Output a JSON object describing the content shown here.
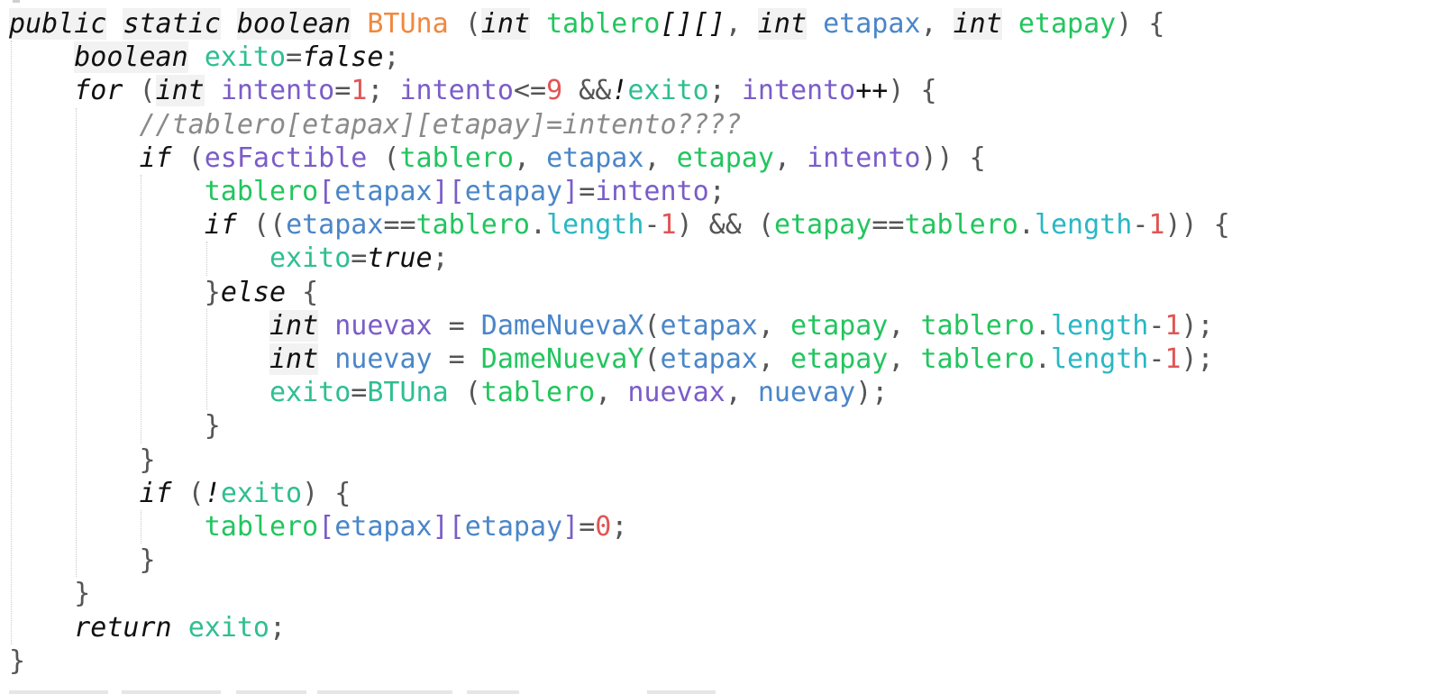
{
  "code": {
    "lines": [
      {
        "tokens": [
          {
            "t": "public",
            "c": "kwbg"
          },
          {
            "t": " ",
            "c": "pu"
          },
          {
            "t": "static",
            "c": "kwbg"
          },
          {
            "t": " ",
            "c": "pu"
          },
          {
            "t": "boolean",
            "c": "kwbg"
          },
          {
            "t": " ",
            "c": "pu"
          },
          {
            "t": "BTUna",
            "c": "orange"
          },
          {
            "t": " (",
            "c": "pu"
          },
          {
            "t": "int",
            "c": "kwbg"
          },
          {
            "t": " ",
            "c": "pu"
          },
          {
            "t": "tablero",
            "c": "green"
          },
          {
            "t": "[][]",
            "c": "kw"
          },
          {
            "t": ", ",
            "c": "pu"
          },
          {
            "t": "int",
            "c": "kwbg"
          },
          {
            "t": " ",
            "c": "pu"
          },
          {
            "t": "etapax",
            "c": "blue"
          },
          {
            "t": ", ",
            "c": "pu"
          },
          {
            "t": "int",
            "c": "kwbg"
          },
          {
            "t": " ",
            "c": "pu"
          },
          {
            "t": "etapay",
            "c": "green"
          },
          {
            "t": ") {",
            "c": "pu"
          }
        ]
      },
      {
        "tokens": [
          {
            "t": "    ",
            "c": "pu"
          },
          {
            "t": "boolean",
            "c": "kwbg"
          },
          {
            "t": " ",
            "c": "pu"
          },
          {
            "t": "exito",
            "c": "teal"
          },
          {
            "t": "=",
            "c": "pu"
          },
          {
            "t": "false",
            "c": "kw"
          },
          {
            "t": ";",
            "c": "pu"
          }
        ]
      },
      {
        "tokens": [
          {
            "t": "    ",
            "c": "pu"
          },
          {
            "t": "for",
            "c": "kw"
          },
          {
            "t": " (",
            "c": "pu"
          },
          {
            "t": "int",
            "c": "kwbg"
          },
          {
            "t": " ",
            "c": "pu"
          },
          {
            "t": "intento",
            "c": "purple"
          },
          {
            "t": "=",
            "c": "pu"
          },
          {
            "t": "1",
            "c": "red"
          },
          {
            "t": "; ",
            "c": "pu"
          },
          {
            "t": "intento",
            "c": "purple"
          },
          {
            "t": "<=",
            "c": "pu"
          },
          {
            "t": "9",
            "c": "red"
          },
          {
            "t": " &&",
            "c": "pu"
          },
          {
            "t": "!",
            "c": "kw"
          },
          {
            "t": "exito",
            "c": "teal"
          },
          {
            "t": "; ",
            "c": "pu"
          },
          {
            "t": "intento",
            "c": "purple"
          },
          {
            "t": "++",
            "c": "kw"
          },
          {
            "t": ") {",
            "c": "pu"
          }
        ]
      },
      {
        "tokens": [
          {
            "t": "        ",
            "c": "pu"
          },
          {
            "t": "//tablero[etapax][etapay]=intento????",
            "c": "comment"
          }
        ]
      },
      {
        "tokens": [
          {
            "t": "        ",
            "c": "pu"
          },
          {
            "t": "if",
            "c": "kw"
          },
          {
            "t": " (",
            "c": "pu"
          },
          {
            "t": "esFactible",
            "c": "purple"
          },
          {
            "t": " (",
            "c": "pu"
          },
          {
            "t": "tablero",
            "c": "green"
          },
          {
            "t": ", ",
            "c": "pu"
          },
          {
            "t": "etapax",
            "c": "blue"
          },
          {
            "t": ", ",
            "c": "pu"
          },
          {
            "t": "etapay",
            "c": "green"
          },
          {
            "t": ", ",
            "c": "pu"
          },
          {
            "t": "intento",
            "c": "purple"
          },
          {
            "t": ")) {",
            "c": "pu"
          }
        ]
      },
      {
        "tokens": [
          {
            "t": "            ",
            "c": "pu"
          },
          {
            "t": "tablero",
            "c": "green"
          },
          {
            "t": "[",
            "c": "purple"
          },
          {
            "t": "etapax",
            "c": "blue"
          },
          {
            "t": "]",
            "c": "purple"
          },
          {
            "t": "[",
            "c": "purple"
          },
          {
            "t": "etapay",
            "c": "blue"
          },
          {
            "t": "]",
            "c": "purple"
          },
          {
            "t": "=",
            "c": "pu"
          },
          {
            "t": "intento",
            "c": "purple"
          },
          {
            "t": ";",
            "c": "pu"
          }
        ]
      },
      {
        "tokens": [
          {
            "t": "            ",
            "c": "pu"
          },
          {
            "t": "if",
            "c": "kw"
          },
          {
            "t": " ((",
            "c": "pu"
          },
          {
            "t": "etapax",
            "c": "blue"
          },
          {
            "t": "==",
            "c": "pu"
          },
          {
            "t": "tablero",
            "c": "green"
          },
          {
            "t": ".",
            "c": "pu"
          },
          {
            "t": "length",
            "c": "cyan"
          },
          {
            "t": "-",
            "c": "pu"
          },
          {
            "t": "1",
            "c": "red"
          },
          {
            "t": ") && (",
            "c": "pu"
          },
          {
            "t": "etapay",
            "c": "green"
          },
          {
            "t": "==",
            "c": "pu"
          },
          {
            "t": "tablero",
            "c": "green"
          },
          {
            "t": ".",
            "c": "pu"
          },
          {
            "t": "length",
            "c": "cyan"
          },
          {
            "t": "-",
            "c": "pu"
          },
          {
            "t": "1",
            "c": "red"
          },
          {
            "t": ")) {",
            "c": "pu"
          }
        ]
      },
      {
        "tokens": [
          {
            "t": "                ",
            "c": "pu"
          },
          {
            "t": "exito",
            "c": "teal"
          },
          {
            "t": "=",
            "c": "pu"
          },
          {
            "t": "true",
            "c": "kw"
          },
          {
            "t": ";",
            "c": "pu"
          }
        ]
      },
      {
        "tokens": [
          {
            "t": "            ",
            "c": "pu"
          },
          {
            "t": "}",
            "c": "pu"
          },
          {
            "t": "else",
            "c": "kw"
          },
          {
            "t": " {",
            "c": "pu"
          }
        ]
      },
      {
        "tokens": [
          {
            "t": "                ",
            "c": "pu"
          },
          {
            "t": "int",
            "c": "kwbg"
          },
          {
            "t": " ",
            "c": "pu"
          },
          {
            "t": "nuevax",
            "c": "purple"
          },
          {
            "t": " = ",
            "c": "pu"
          },
          {
            "t": "DameNuevaX",
            "c": "blue"
          },
          {
            "t": "(",
            "c": "pu"
          },
          {
            "t": "etapax",
            "c": "blue"
          },
          {
            "t": ", ",
            "c": "pu"
          },
          {
            "t": "etapay",
            "c": "green"
          },
          {
            "t": ", ",
            "c": "pu"
          },
          {
            "t": "tablero",
            "c": "green"
          },
          {
            "t": ".",
            "c": "pu"
          },
          {
            "t": "length",
            "c": "cyan"
          },
          {
            "t": "-",
            "c": "pu"
          },
          {
            "t": "1",
            "c": "red"
          },
          {
            "t": ");",
            "c": "pu"
          }
        ]
      },
      {
        "tokens": [
          {
            "t": "                ",
            "c": "pu"
          },
          {
            "t": "int",
            "c": "kwbg"
          },
          {
            "t": " ",
            "c": "pu"
          },
          {
            "t": "nuevay",
            "c": "blue"
          },
          {
            "t": " = ",
            "c": "pu"
          },
          {
            "t": "DameNuevaY",
            "c": "green"
          },
          {
            "t": "(",
            "c": "pu"
          },
          {
            "t": "etapax",
            "c": "blue"
          },
          {
            "t": ", ",
            "c": "pu"
          },
          {
            "t": "etapay",
            "c": "green"
          },
          {
            "t": ", ",
            "c": "pu"
          },
          {
            "t": "tablero",
            "c": "green"
          },
          {
            "t": ".",
            "c": "pu"
          },
          {
            "t": "length",
            "c": "cyan"
          },
          {
            "t": "-",
            "c": "pu"
          },
          {
            "t": "1",
            "c": "red"
          },
          {
            "t": ");",
            "c": "pu"
          }
        ]
      },
      {
        "tokens": [
          {
            "t": "                ",
            "c": "pu"
          },
          {
            "t": "exito",
            "c": "teal"
          },
          {
            "t": "=",
            "c": "pu"
          },
          {
            "t": "BTUna",
            "c": "teal"
          },
          {
            "t": " (",
            "c": "pu"
          },
          {
            "t": "tablero",
            "c": "green"
          },
          {
            "t": ", ",
            "c": "pu"
          },
          {
            "t": "nuevax",
            "c": "purple"
          },
          {
            "t": ", ",
            "c": "pu"
          },
          {
            "t": "nuevay",
            "c": "blue"
          },
          {
            "t": ");",
            "c": "pu"
          }
        ]
      },
      {
        "tokens": [
          {
            "t": "            ",
            "c": "pu"
          },
          {
            "t": "}",
            "c": "pu"
          }
        ]
      },
      {
        "tokens": [
          {
            "t": "        ",
            "c": "pu"
          },
          {
            "t": "}",
            "c": "pu"
          }
        ]
      },
      {
        "tokens": [
          {
            "t": "        ",
            "c": "pu"
          },
          {
            "t": "if",
            "c": "kw"
          },
          {
            "t": " (",
            "c": "pu"
          },
          {
            "t": "!",
            "c": "kw"
          },
          {
            "t": "exito",
            "c": "teal"
          },
          {
            "t": ") {",
            "c": "pu"
          }
        ]
      },
      {
        "tokens": [
          {
            "t": "            ",
            "c": "pu"
          },
          {
            "t": "tablero",
            "c": "green"
          },
          {
            "t": "[",
            "c": "purple"
          },
          {
            "t": "etapax",
            "c": "blue"
          },
          {
            "t": "]",
            "c": "purple"
          },
          {
            "t": "[",
            "c": "purple"
          },
          {
            "t": "etapay",
            "c": "blue"
          },
          {
            "t": "]",
            "c": "purple"
          },
          {
            "t": "=",
            "c": "pu"
          },
          {
            "t": "0",
            "c": "red"
          },
          {
            "t": ";",
            "c": "pu"
          }
        ]
      },
      {
        "tokens": [
          {
            "t": "        ",
            "c": "pu"
          },
          {
            "t": "}",
            "c": "pu"
          }
        ]
      },
      {
        "tokens": [
          {
            "t": "    ",
            "c": "pu"
          },
          {
            "t": "}",
            "c": "pu"
          }
        ]
      },
      {
        "tokens": [
          {
            "t": "    ",
            "c": "pu"
          },
          {
            "t": "return",
            "c": "kw"
          },
          {
            "t": " ",
            "c": "pu"
          },
          {
            "t": "exito",
            "c": "teal"
          },
          {
            "t": ";",
            "c": "pu"
          }
        ]
      },
      {
        "tokens": [
          {
            "t": "}",
            "c": "pu"
          }
        ]
      }
    ]
  },
  "colors": {
    "background": "#ffffff",
    "keyword": "#111111",
    "keyword_highlight": "#f2f2f2",
    "method_name": "#f0883e",
    "identifier_green": "#22c55e",
    "identifier_teal": "#2ebf91",
    "identifier_blue": "#4a86c8",
    "identifier_purple": "#7b5cc9",
    "number": "#e05555",
    "field": "#2ab7c4",
    "comment": "#8a8a8a",
    "punctuation": "#555555"
  }
}
